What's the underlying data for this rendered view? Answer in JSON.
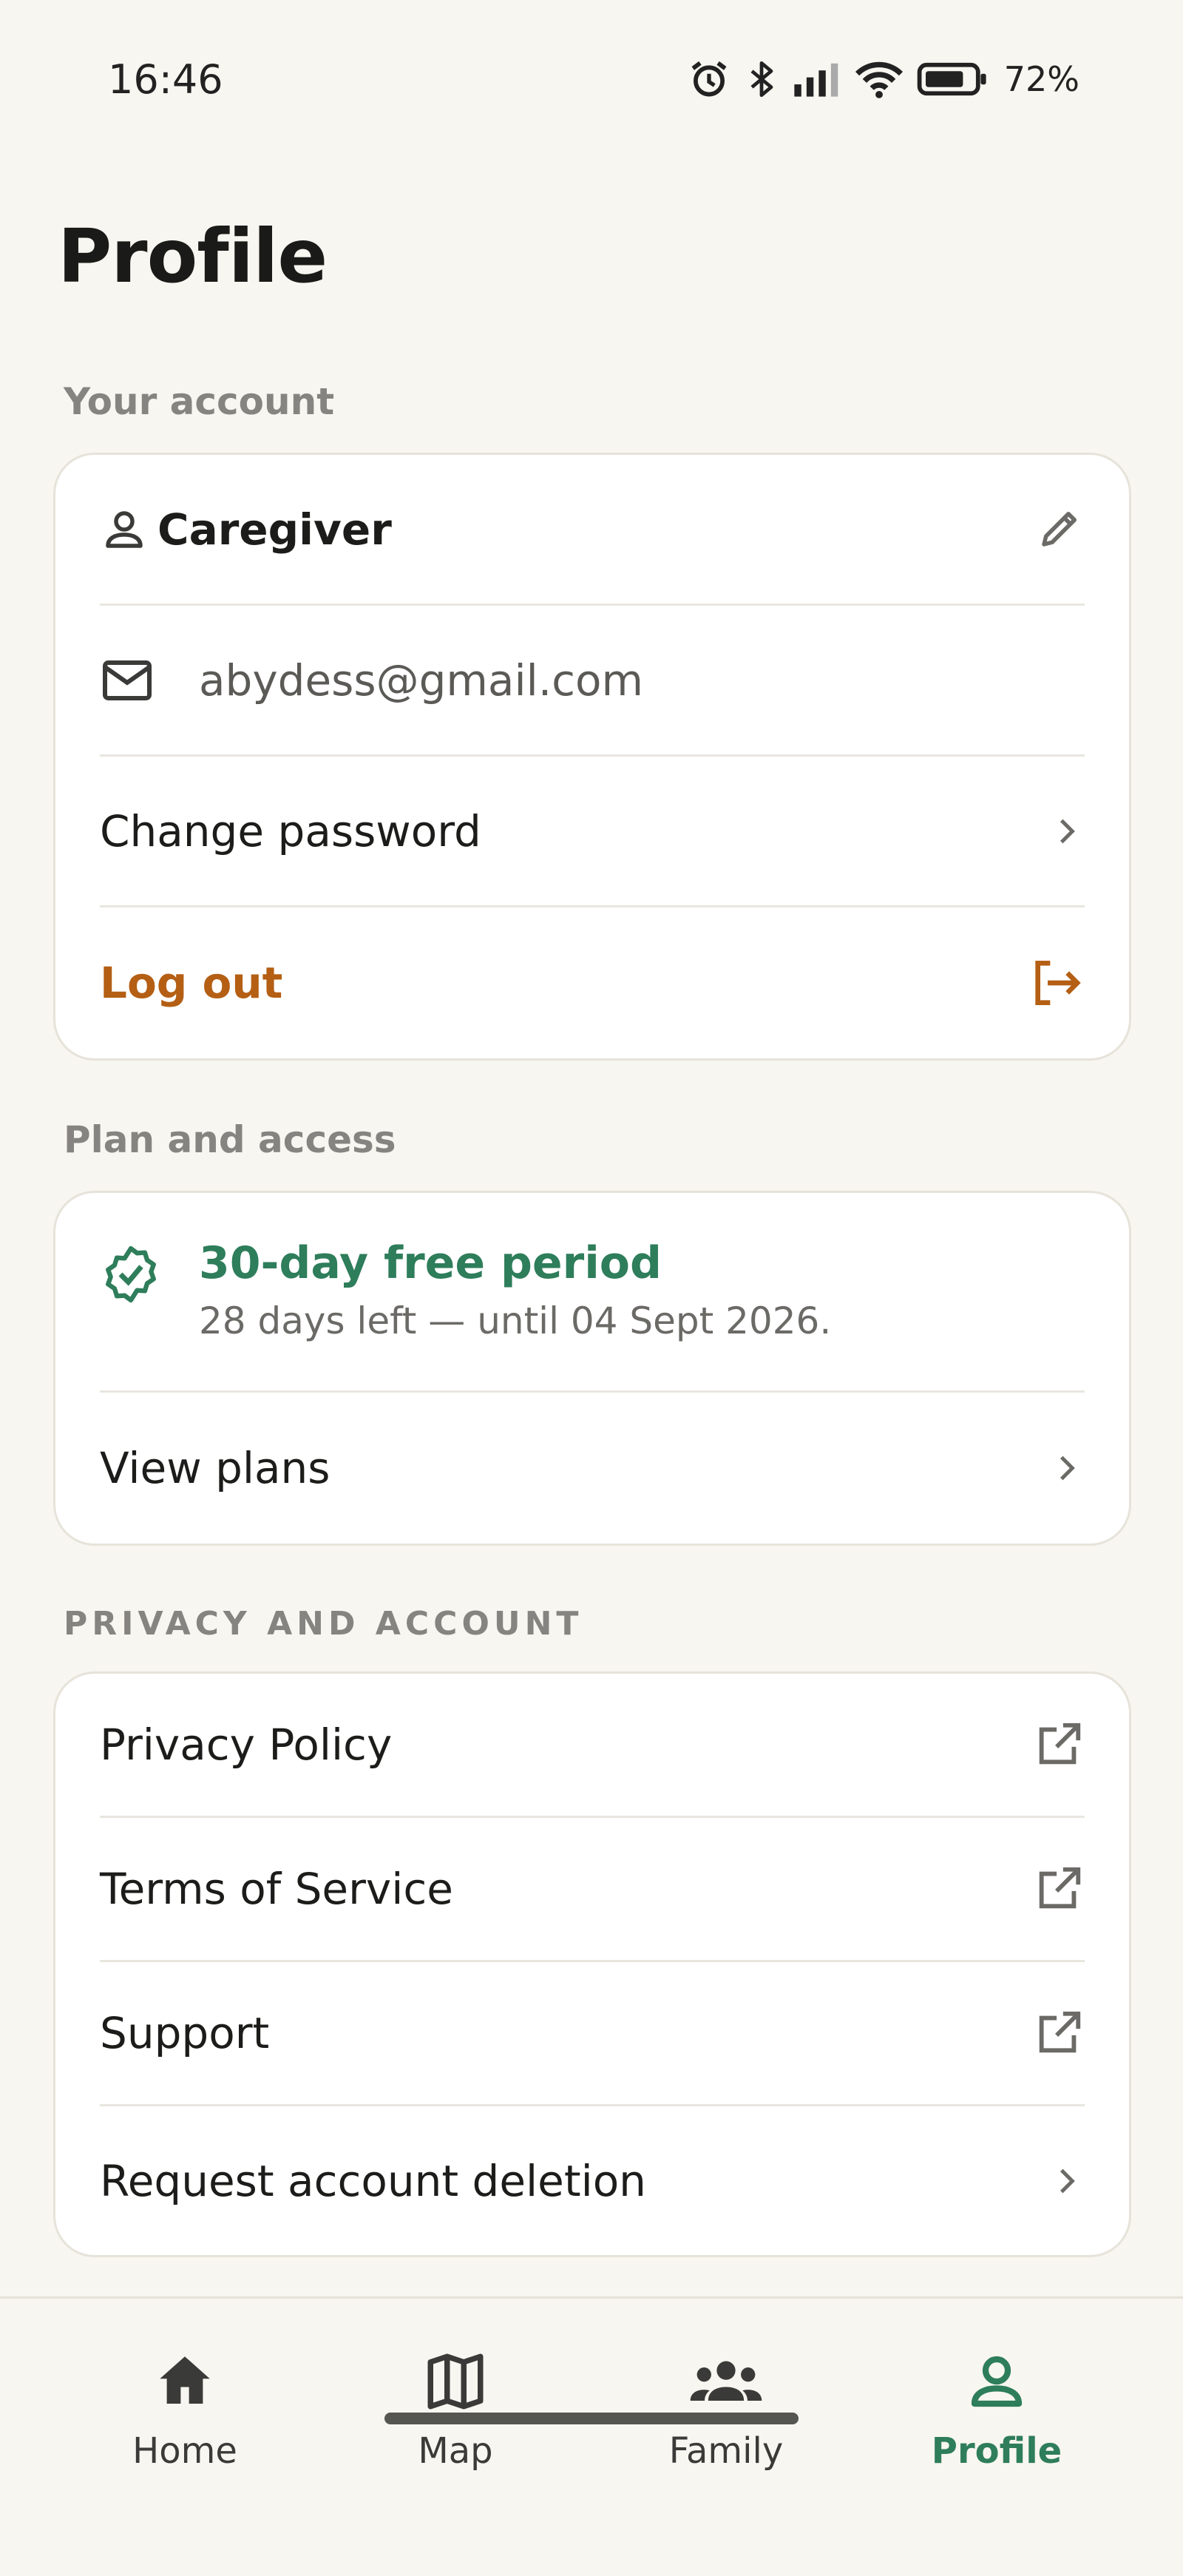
{
  "status_bar": {
    "time": "16:46",
    "battery": "72%",
    "icons": [
      "alarm-icon",
      "bluetooth-icon",
      "signal-icon",
      "wifi-icon",
      "battery-icon"
    ]
  },
  "page": {
    "title": "Profile"
  },
  "account_section": {
    "label": "Your account",
    "name": "Caregiver",
    "email": "abydess@gmail.com",
    "change_password": "Change password",
    "logout": "Log out"
  },
  "plan_section": {
    "label": "Plan and access",
    "plan_title": "30-day free period",
    "plan_subtitle": "28 days left — until 04 Sept 2026.",
    "view_plans": "View plans"
  },
  "privacy_section": {
    "label": "PRIVACY AND ACCOUNT",
    "items": [
      {
        "label": "Privacy Policy",
        "trail": "external-link-icon"
      },
      {
        "label": "Terms of Service",
        "trail": "external-link-icon"
      },
      {
        "label": "Support",
        "trail": "external-link-icon"
      },
      {
        "label": "Request account deletion",
        "trail": "chevron-right-icon"
      }
    ]
  },
  "bottom_nav": {
    "items": [
      {
        "label": "Home",
        "icon": "home-icon"
      },
      {
        "label": "Map",
        "icon": "map-icon"
      },
      {
        "label": "Family",
        "icon": "family-icon"
      },
      {
        "label": "Profile",
        "icon": "profile-icon",
        "active": true
      }
    ]
  },
  "colors": {
    "background": "#f8f6f0",
    "accent_green": "#2e7d5b",
    "logout_orange": "#b45f14",
    "card": "#ffffff"
  }
}
